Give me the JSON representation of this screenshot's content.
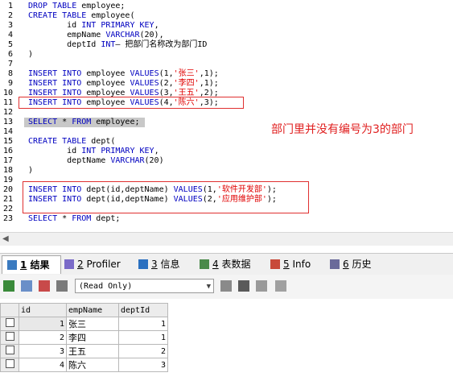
{
  "editor": {
    "line_numbers": [
      "1",
      "2",
      "3",
      "4",
      "5",
      "6",
      "7",
      "8",
      "9",
      "10",
      "11",
      "12",
      "13",
      "14",
      "15",
      "16",
      "17",
      "18",
      "19",
      "20",
      "21",
      "22",
      "23"
    ],
    "lines": [
      "DROP TABLE employee;",
      "CREATE TABLE employee(",
      "        id INT PRIMARY KEY,",
      "        empName VARCHAR(20),",
      "        deptId INT— 把部门名称改为部门ID",
      ")",
      "",
      "INSERT INTO employee VALUES(1,'张三',1);",
      "INSERT INTO employee VALUES(2,'李四',1);",
      "INSERT INTO employee VALUES(3,'王五',2);",
      "INSERT INTO employee VALUES(4,'陈六',3);",
      "",
      "SELECT * FROM employee;",
      "",
      "CREATE TABLE dept(",
      "        id INT PRIMARY KEY,",
      "        deptName VARCHAR(20)",
      ")",
      "",
      "INSERT INTO dept(id,deptName) VALUES(1,'软件开发部');",
      "INSERT INTO dept(id,deptName) VALUES(2,'应用维护部');",
      "",
      "SELECT * FROM dept;"
    ],
    "annotation": "部门里并没有编号为3的部门"
  },
  "tabs": [
    {
      "num": "1",
      "label": "结果",
      "icon": "result-grid-icon"
    },
    {
      "num": "2",
      "label": "Profiler",
      "icon": "profiler-icon"
    },
    {
      "num": "3",
      "label": "信息",
      "icon": "info-icon"
    },
    {
      "num": "4",
      "label": "表数据",
      "icon": "table-data-icon"
    },
    {
      "num": "5",
      "label": "Info",
      "icon": "info-chart-icon"
    },
    {
      "num": "6",
      "label": "历史",
      "icon": "history-icon"
    }
  ],
  "toolbar": {
    "mode_select": "(Read Only)"
  },
  "grid": {
    "headers": [
      "id",
      "empName",
      "deptId"
    ],
    "rows": [
      [
        "1",
        "张三",
        "1"
      ],
      [
        "2",
        "李四",
        "1"
      ],
      [
        "3",
        "王五",
        "2"
      ],
      [
        "4",
        "陈六",
        "3"
      ]
    ]
  },
  "colors": {
    "keyword": "#0000c0",
    "string": "#e00000",
    "annotation": "#e02020",
    "highlight_box": "#e03030"
  }
}
